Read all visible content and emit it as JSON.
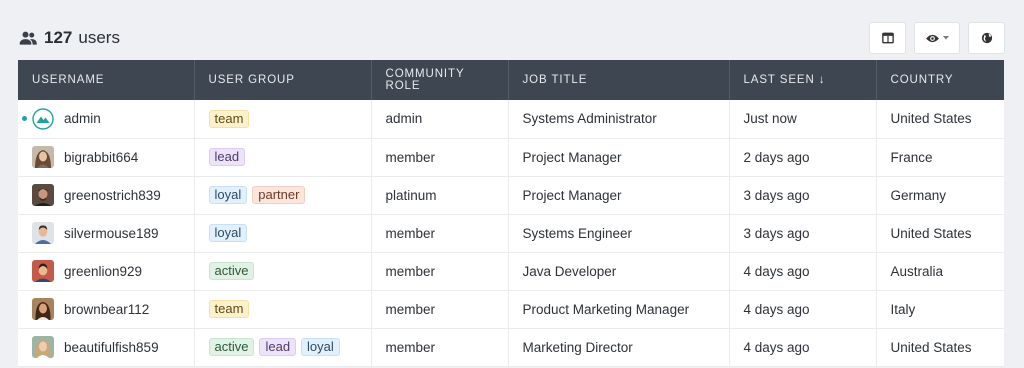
{
  "header": {
    "user_count": "127",
    "users_label": "users"
  },
  "toolbar": {
    "buttons": [
      {
        "icon": "table-columns-icon"
      },
      {
        "icon": "eye-icon"
      },
      {
        "icon": "globe-icon"
      }
    ]
  },
  "table": {
    "columns": [
      "USERNAME",
      "USER GROUP",
      "COMMUNITY ROLE",
      "JOB TITLE",
      "LAST SEEN ↓",
      "COUNTRY"
    ],
    "rows": [
      {
        "username": "admin",
        "groups": [
          "team"
        ],
        "role": "admin",
        "job": "Systems Administrator",
        "last_seen": "Just now",
        "country": "United States",
        "online": true
      },
      {
        "username": "bigrabbit664",
        "groups": [
          "lead"
        ],
        "role": "member",
        "job": "Project Manager",
        "last_seen": "2 days ago",
        "country": "France"
      },
      {
        "username": "greenostrich839",
        "groups": [
          "loyal",
          "partner"
        ],
        "role": "platinum",
        "job": "Project Manager",
        "last_seen": "3 days ago",
        "country": "Germany"
      },
      {
        "username": "silvermouse189",
        "groups": [
          "loyal"
        ],
        "role": "member",
        "job": "Systems Engineer",
        "last_seen": "3 days ago",
        "country": "United States"
      },
      {
        "username": "greenlion929",
        "groups": [
          "active"
        ],
        "role": "member",
        "job": "Java Developer",
        "last_seen": "4 days ago",
        "country": "Australia"
      },
      {
        "username": "brownbear112",
        "groups": [
          "team"
        ],
        "role": "member",
        "job": "Product Marketing Manager",
        "last_seen": "4 days ago",
        "country": "Italy"
      },
      {
        "username": "beautifulfish859",
        "groups": [
          "active",
          "lead",
          "loyal"
        ],
        "role": "member",
        "job": "Marketing Director",
        "last_seen": "4 days ago",
        "country": "United States"
      }
    ]
  },
  "colors": {
    "header_bg": "#3e4651",
    "online_dot": "#17a2b8",
    "team": "#fdf1cc",
    "lead": "#ece3f8",
    "loyal": "#e1f0fc",
    "partner": "#fde5dc",
    "active": "#dff2e4"
  }
}
